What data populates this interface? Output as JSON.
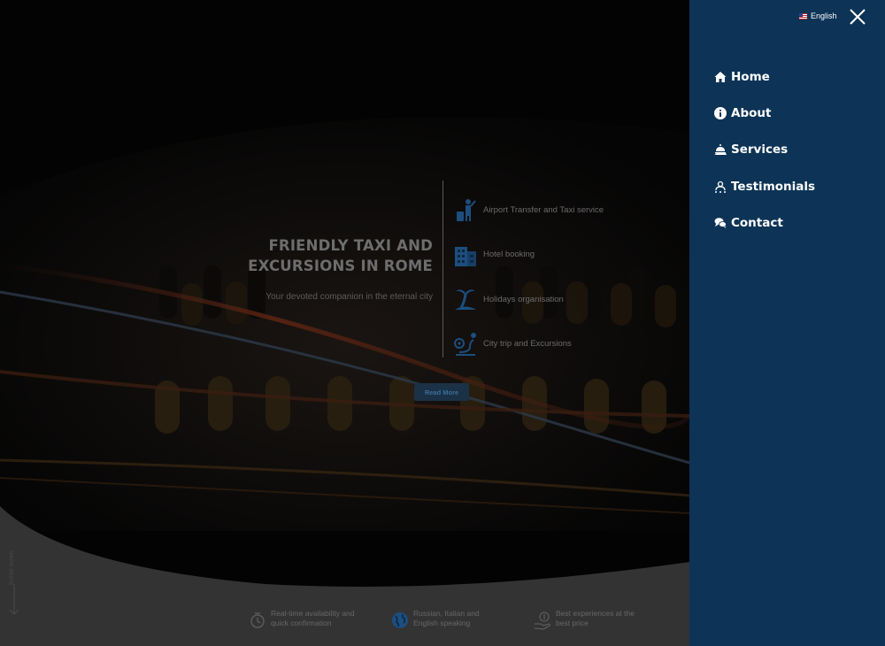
{
  "hero": {
    "headline_line1": "FRIENDLY TAXI AND",
    "headline_line2": "EXCURSIONS IN ROME",
    "subtitle": "Your devoted companion in the eternal city",
    "read_more": "Read More",
    "scroll_down": "Scroll down"
  },
  "services": [
    {
      "label": "Airport Transfer and Taxi service",
      "icon": "traveler-icon"
    },
    {
      "label": "Hotel booking",
      "icon": "hotel-icon"
    },
    {
      "label": "Holidays organisation",
      "icon": "palm-tree-icon"
    },
    {
      "label": "City trip and Excursions",
      "icon": "map-route-icon"
    }
  ],
  "features": [
    {
      "line1": "Real-time availability and",
      "line2": "quick confirmation",
      "icon": "clock-check-icon"
    },
    {
      "line1": "Russian, Italian and",
      "line2": "English speaking",
      "icon": "globe-icon"
    },
    {
      "line1": "Best experiences at the",
      "line2": "best price",
      "icon": "price-hand-icon"
    }
  ],
  "menu": {
    "language": "English",
    "items": [
      {
        "label": "Home",
        "icon": "home-icon"
      },
      {
        "label": "About",
        "icon": "info-icon"
      },
      {
        "label": "Services",
        "icon": "service-bell-icon"
      },
      {
        "label": "Testimonials",
        "icon": "users-stars-icon"
      },
      {
        "label": "Contact",
        "icon": "chat-bubbles-icon"
      }
    ]
  },
  "colors": {
    "panel_bg": "#0d3456",
    "accent": "#1e6fb8",
    "overlay_text": "#6d6d6d"
  }
}
